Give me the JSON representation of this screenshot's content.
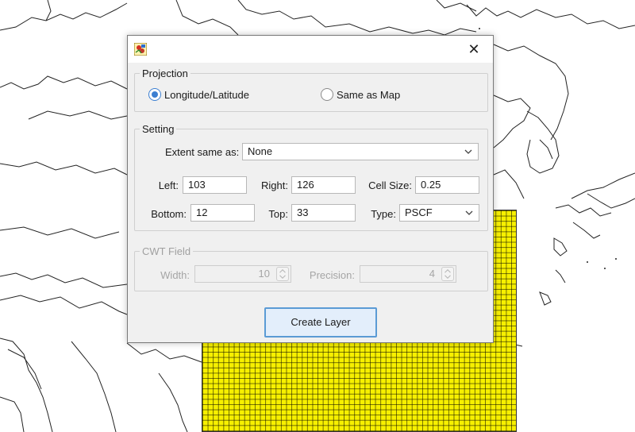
{
  "dialog": {
    "title": "",
    "close_symbol": "✕"
  },
  "projection": {
    "legend": "Projection",
    "options": [
      {
        "label": "Longitude/Latitude",
        "selected": true
      },
      {
        "label": "Same as Map",
        "selected": false
      }
    ]
  },
  "setting": {
    "legend": "Setting",
    "extent_label": "Extent same as:",
    "extent_value": "None",
    "left_label": "Left:",
    "left_value": "103",
    "right_label": "Right:",
    "right_value": "126",
    "cellsize_label": "Cell Size:",
    "cellsize_value": "0.25",
    "bottom_label": "Bottom:",
    "bottom_value": "12",
    "top_label": "Top:",
    "top_value": "33",
    "type_label": "Type:",
    "type_value": "PSCF"
  },
  "cwt": {
    "legend": "CWT Field",
    "width_label": "Width:",
    "width_value": "10",
    "precision_label": "Precision:",
    "precision_value": "4"
  },
  "create_button": "Create Layer",
  "colors": {
    "grid_fill": "#f7f000",
    "accent": "#3c7fd1",
    "button_border": "#5b9bd5"
  },
  "icons": [
    "app-icon",
    "close-icon",
    "chevron-down-icon",
    "spinner-arrows-icon"
  ]
}
